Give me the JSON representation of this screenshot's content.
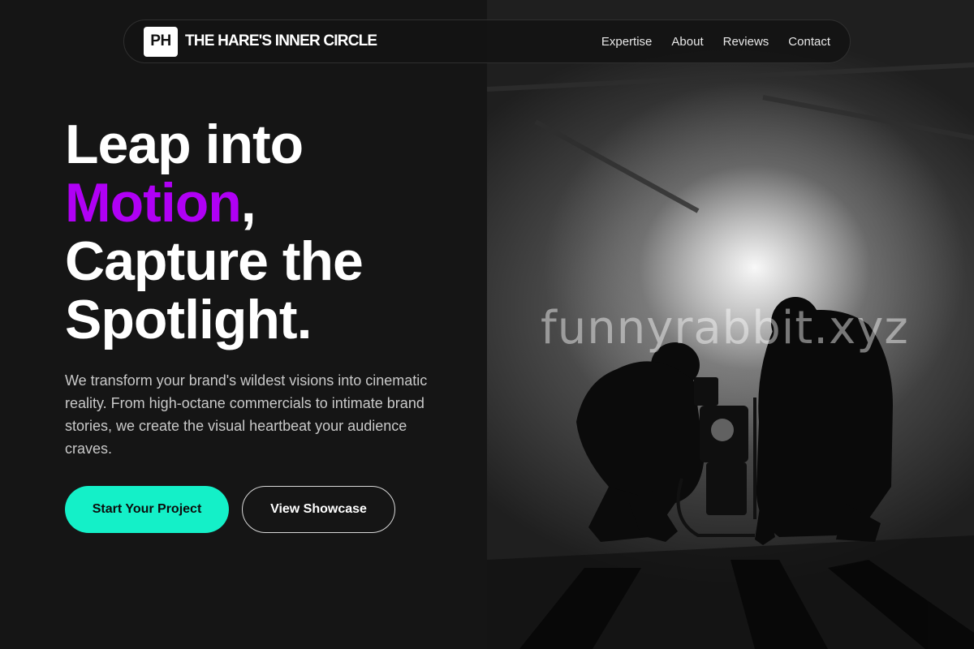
{
  "nav": {
    "logo_text": "PH",
    "brand": "THE HARE'S INNER CIRCLE",
    "links": [
      "Expertise",
      "About",
      "Reviews",
      "Contact"
    ]
  },
  "hero": {
    "line1": "Leap into",
    "accent": "Motion",
    "comma": ",",
    "line3": "Capture the",
    "line4": "Spotlight.",
    "description": "We transform your brand's wildest visions into cinematic reality. From high-octane commercials to intimate brand stories, we create the visual heartbeat your audience craves.",
    "primary_cta": "Start Your Project",
    "secondary_cta": "View Showcase"
  },
  "photo": {
    "watermark": "funnyrabbit.xyz"
  },
  "colors": {
    "background": "#151515",
    "accent_purple": "#b000f5",
    "cta_teal": "#14f0c8"
  }
}
